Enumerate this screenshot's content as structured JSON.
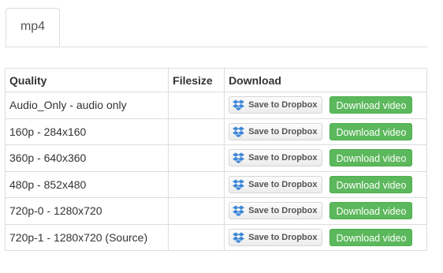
{
  "tabs": [
    {
      "label": "mp4",
      "active": true
    }
  ],
  "table": {
    "headers": {
      "quality": "Quality",
      "filesize": "Filesize",
      "download": "Download"
    },
    "rows": [
      {
        "quality": "Audio_Only - audio only",
        "filesize": "",
        "dropbox_label": "Save to Dropbox",
        "download_label": "Download video"
      },
      {
        "quality": "160p - 284x160",
        "filesize": "",
        "dropbox_label": "Save to Dropbox",
        "download_label": "Download video"
      },
      {
        "quality": "360p - 640x360",
        "filesize": "",
        "dropbox_label": "Save to Dropbox",
        "download_label": "Download video"
      },
      {
        "quality": "480p - 852x480",
        "filesize": "",
        "dropbox_label": "Save to Dropbox",
        "download_label": "Download video"
      },
      {
        "quality": "720p-0 - 1280x720",
        "filesize": "",
        "dropbox_label": "Save to Dropbox",
        "download_label": "Download video"
      },
      {
        "quality": "720p-1 - 1280x720 (Source)",
        "filesize": "",
        "dropbox_label": "Save to Dropbox",
        "download_label": "Download video"
      }
    ]
  },
  "icons": {
    "dropbox": "dropbox-icon"
  },
  "colors": {
    "download_button": "#5cb85c",
    "dropbox_blue": "#3d88d8",
    "border": "#dddddd"
  }
}
